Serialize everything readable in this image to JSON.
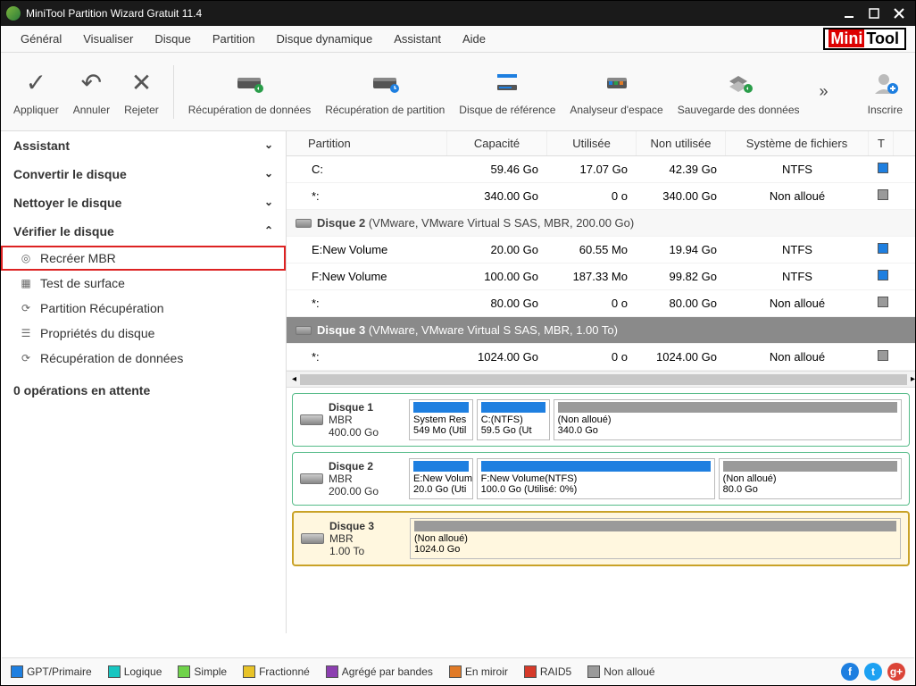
{
  "window": {
    "title": "MiniTool Partition Wizard Gratuit 11.4"
  },
  "menu": {
    "items": [
      "Général",
      "Visualiser",
      "Disque",
      "Partition",
      "Disque dynamique",
      "Assistant",
      "Aide"
    ],
    "brand_a": "Mini",
    "brand_b": "Tool"
  },
  "toolbar": {
    "apply": "Appliquer",
    "undo": "Annuler",
    "discard": "Rejeter",
    "data_recovery": "Récupération de données",
    "partition_recovery": "Récupération de partition",
    "benchmark": "Disque de référence",
    "space_analyzer": "Analyseur d'espace",
    "data_backup": "Sauvegarde des données",
    "more": "»",
    "signup": "Inscrire"
  },
  "sidebar": {
    "cats": [
      {
        "label": "Assistant",
        "open": false
      },
      {
        "label": "Convertir le disque",
        "open": false
      },
      {
        "label": "Nettoyer le disque",
        "open": false
      },
      {
        "label": "Vérifier le disque",
        "open": true
      }
    ],
    "items": [
      {
        "icon": "target-icon",
        "label": "Recréer MBR",
        "selected": true
      },
      {
        "icon": "grid-icon",
        "label": "Test de surface",
        "selected": false
      },
      {
        "icon": "recover-icon",
        "label": "Partition Récupération",
        "selected": false
      },
      {
        "icon": "props-icon",
        "label": "Propriétés du disque",
        "selected": false
      },
      {
        "icon": "recover-icon",
        "label": "Récupération de données",
        "selected": false
      }
    ],
    "pending": "0 opérations en attente"
  },
  "grid": {
    "headers": {
      "partition": "Partition",
      "capacity": "Capacité",
      "used": "Utilisée",
      "free": "Non utilisée",
      "fs": "Système de fichiers",
      "type": "T"
    },
    "groups": [
      {
        "header": null,
        "rows": [
          {
            "part": "C:",
            "cap": "59.46 Go",
            "used": "17.07 Go",
            "free": "42.39 Go",
            "fs": "NTFS",
            "color": "#1e7fe0"
          },
          {
            "part": "*:",
            "cap": "340.00 Go",
            "used": "0 o",
            "free": "340.00 Go",
            "fs": "Non alloué",
            "color": "#9a9a9a"
          }
        ]
      },
      {
        "header": {
          "name": "Disque 2",
          "meta": "(VMware, VMware Virtual S SAS, MBR, 200.00 Go)",
          "selected": false
        },
        "rows": [
          {
            "part": "E:New Volume",
            "cap": "20.00 Go",
            "used": "60.55 Mo",
            "free": "19.94 Go",
            "fs": "NTFS",
            "color": "#1e7fe0"
          },
          {
            "part": "F:New Volume",
            "cap": "100.00 Go",
            "used": "187.33 Mo",
            "free": "99.82 Go",
            "fs": "NTFS",
            "color": "#1e7fe0"
          },
          {
            "part": "*:",
            "cap": "80.00 Go",
            "used": "0 o",
            "free": "80.00 Go",
            "fs": "Non alloué",
            "color": "#9a9a9a"
          }
        ]
      },
      {
        "header": {
          "name": "Disque 3",
          "meta": "(VMware, VMware Virtual S SAS, MBR, 1.00 To)",
          "selected": true
        },
        "rows": [
          {
            "part": "*:",
            "cap": "1024.00 Go",
            "used": "0 o",
            "free": "1024.00 Go",
            "fs": "Non alloué",
            "color": "#9a9a9a"
          }
        ]
      }
    ]
  },
  "maps": [
    {
      "name": "Disque 1",
      "type": "MBR",
      "size": "400.00 Go",
      "selected": false,
      "segs": [
        {
          "bar": "bar-ntfs",
          "flex": "0.12",
          "l1": "System Res",
          "l2": "549 Mo (Util"
        },
        {
          "bar": "bar-ntfs",
          "flex": "0.14",
          "l1": "C:(NTFS)",
          "l2": "59.5 Go (Ut"
        },
        {
          "bar": "bar-unalloc",
          "flex": "0.74",
          "l1": "(Non alloué)",
          "l2": "340.0 Go"
        }
      ]
    },
    {
      "name": "Disque 2",
      "type": "MBR",
      "size": "200.00 Go",
      "selected": false,
      "segs": [
        {
          "bar": "bar-ntfs",
          "flex": "0.12",
          "l1": "E:New Volum",
          "l2": "20.0 Go (Uti"
        },
        {
          "bar": "bar-ntfs",
          "flex": "0.50",
          "l1": "F:New Volume(NTFS)",
          "l2": "100.0 Go (Utilisé: 0%)"
        },
        {
          "bar": "bar-unalloc",
          "flex": "0.38",
          "l1": "(Non alloué)",
          "l2": "80.0 Go"
        }
      ]
    },
    {
      "name": "Disque 3",
      "type": "MBR",
      "size": "1.00 To",
      "selected": true,
      "segs": [
        {
          "bar": "bar-unalloc",
          "flex": "1",
          "l1": "(Non alloué)",
          "l2": "1024.0 Go"
        }
      ]
    }
  ],
  "legend": [
    {
      "color": "#1e7fe0",
      "label": "GPT/Primaire"
    },
    {
      "color": "#17c6c1",
      "label": "Logique"
    },
    {
      "color": "#6fd24a",
      "label": "Simple"
    },
    {
      "color": "#e8c328",
      "label": "Fractionné"
    },
    {
      "color": "#8c3fb0",
      "label": "Agrégé par bandes"
    },
    {
      "color": "#e07a27",
      "label": "En miroir"
    },
    {
      "color": "#d63a2a",
      "label": "RAID5"
    },
    {
      "color": "#9a9a9a",
      "label": "Non alloué"
    }
  ]
}
